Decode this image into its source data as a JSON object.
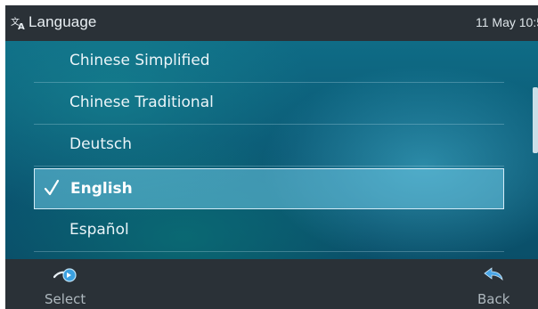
{
  "header": {
    "title": "Language",
    "time": "11 May 10:5",
    "icon": "translate-icon"
  },
  "languages": [
    {
      "label": "Chinese Simplified",
      "selected": false
    },
    {
      "label": "Chinese Traditional",
      "selected": false
    },
    {
      "label": "Deutsch",
      "selected": false
    },
    {
      "label": "English",
      "selected": true
    },
    {
      "label": "Español",
      "selected": false
    }
  ],
  "softkeys": {
    "left": {
      "label": "Select",
      "icon": "select-arrow-icon"
    },
    "right": {
      "label": "Back",
      "icon": "back-arrow-icon"
    }
  },
  "colors": {
    "header_bg": "#2a3137",
    "list_bg": "#0b5a76",
    "selected_bg": "#6ec8e6",
    "icon_blue": "#3aa0e0"
  }
}
